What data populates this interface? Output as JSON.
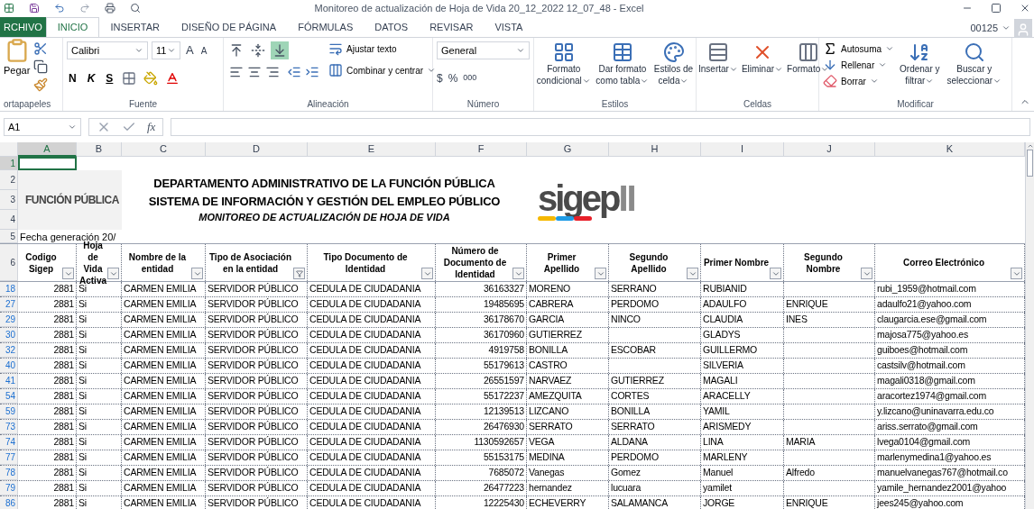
{
  "window": {
    "title": "Monitoreo de actualización de Hoja de Vida 20_12_2022 12_07_48 - Excel",
    "user": "00125"
  },
  "tabs": [
    {
      "label": "RCHIVO",
      "kind": "file",
      "selected": false
    },
    {
      "label": "INICIO",
      "kind": "tab",
      "selected": true
    },
    {
      "label": "INSERTAR",
      "kind": "tab",
      "selected": false
    },
    {
      "label": "DISEÑO DE PÁGINA",
      "kind": "tab",
      "selected": false
    },
    {
      "label": "FÓRMULAS",
      "kind": "tab",
      "selected": false
    },
    {
      "label": "DATOS",
      "kind": "tab",
      "selected": false
    },
    {
      "label": "REVISAR",
      "kind": "tab",
      "selected": false
    },
    {
      "label": "VISTA",
      "kind": "tab",
      "selected": false
    }
  ],
  "ribbon": {
    "portapapeles": {
      "paste": "Pegar",
      "label": "ortapapeles"
    },
    "fuente": {
      "font": "Calibri",
      "size": "11",
      "grow": "A",
      "shrink": "A",
      "bold": "N",
      "italic": "K",
      "underline": "S",
      "label": "Fuente"
    },
    "alineacion": {
      "vertical": [
        {
          "selected": false
        },
        {
          "selected": false
        },
        {
          "selected": true
        }
      ],
      "wrap": "Ajustar texto",
      "merge": "Combinar y centrar",
      "label": "Alineación"
    },
    "numero": {
      "format": "General",
      "currency": "$",
      "percent": "%",
      "thousands": "000",
      "label": "Número"
    },
    "estilos": {
      "buttons": [
        {
          "lines": [
            "Formato",
            "condicional"
          ]
        },
        {
          "lines": [
            "Dar formato",
            "como tabla"
          ]
        },
        {
          "lines": [
            "Estilos de",
            "celda"
          ]
        }
      ],
      "label": "Estilos"
    },
    "celdas": {
      "buttons": [
        "Insertar",
        "Eliminar",
        "Formato"
      ],
      "label": "Celdas"
    },
    "modificar": {
      "autosum": "Autosuma",
      "fill": "Rellenar",
      "clear": "Borrar",
      "buttons": [
        {
          "lines": [
            "Ordenar y",
            "filtrar"
          ]
        },
        {
          "lines": [
            "Buscar y",
            "seleccionar"
          ]
        }
      ],
      "label": "Modificar"
    }
  },
  "formula_bar": {
    "name_box": "A1",
    "fx": "fx"
  },
  "sheet": {
    "column_letters": [
      {
        "label": "A",
        "selected": true
      },
      {
        "label": "B",
        "selected": false
      },
      {
        "label": "C",
        "selected": false
      },
      {
        "label": "D",
        "selected": false
      },
      {
        "label": "E",
        "selected": false
      },
      {
        "label": "F",
        "selected": false
      },
      {
        "label": "G",
        "selected": false
      },
      {
        "label": "H",
        "selected": false
      },
      {
        "label": "I",
        "selected": false
      },
      {
        "label": "J",
        "selected": false
      },
      {
        "label": "K",
        "selected": false
      }
    ],
    "top_rows": [
      {
        "label": "1",
        "selected": true
      },
      {
        "label": "2",
        "selected": false
      },
      {
        "label": "3",
        "selected": false
      },
      {
        "label": "4",
        "selected": false
      },
      {
        "label": "5",
        "selected": false
      }
    ],
    "header": {
      "logo_text": "FUNCIÓN PÚBLICA",
      "titles": [
        "DEPARTAMENTO ADMINISTRATIVO DE LA FUNCIÓN PÚBLICA",
        "SISTEMA DE INFORMACIÓN Y GESTIÓN DEL EMPLEO PÚBLICO"
      ],
      "subtitle": "MONITOREO DE ACTUALIZACIÓN DE HOJA DE VIDA",
      "sigep": "sigep",
      "sigep_suffix": "II",
      "date": "Fecha generación 20/"
    },
    "table": {
      "row_number": "6",
      "columns": [
        {
          "label": "Codigo Sigep",
          "filter_active": false
        },
        {
          "label": "Hoja de Vida Activa",
          "filter_active": false
        },
        {
          "label": "Nombre de la entidad",
          "filter_active": false
        },
        {
          "label": "Tipo de Asociación en la entidad",
          "filter_active": true
        },
        {
          "label": "Tipo Documento de Identidad",
          "filter_active": false
        },
        {
          "label": "Número de Documento de Identidad",
          "filter_active": false
        },
        {
          "label": "Primer Apellido",
          "filter_active": false
        },
        {
          "label": "Segundo Apellido",
          "filter_active": false
        },
        {
          "label": "Primer Nombre",
          "filter_active": false
        },
        {
          "label": "Segundo Nombre",
          "filter_active": false
        },
        {
          "label": "Correo Electrónico",
          "filter_active": false
        }
      ],
      "rows": [
        {
          "row_number": "18",
          "cells": [
            "2881",
            "Si",
            "CARMEN EMILIA",
            "SERVIDOR PÚBLICO",
            "CEDULA DE CIUDADANIA",
            "36163327",
            "MORENO",
            "SERRANO",
            "RUBIANID",
            "",
            "rubi_1959@hotmail.com"
          ]
        },
        {
          "row_number": "27",
          "cells": [
            "2881",
            "Si",
            "CARMEN EMILIA",
            "SERVIDOR PÚBLICO",
            "CEDULA DE CIUDADANIA",
            "19485695",
            "CABRERA",
            "PERDOMO",
            "ADAULFO",
            "ENRIQUE",
            "adaulfo21@yahoo.com"
          ]
        },
        {
          "row_number": "29",
          "cells": [
            "2881",
            "Si",
            "CARMEN EMILIA",
            "SERVIDOR PÚBLICO",
            "CEDULA DE CIUDADANIA",
            "36178670",
            "GARCIA",
            "NINCO",
            "CLAUDIA",
            "INES",
            "claugarcia.ese@gmail.com"
          ]
        },
        {
          "row_number": "30",
          "cells": [
            "2881",
            "Si",
            "CARMEN EMILIA",
            "SERVIDOR PÚBLICO",
            "CEDULA DE CIUDADANIA",
            "36170960",
            "GUTIERREZ",
            "",
            "GLADYS",
            "",
            "majosa775@yahoo.es"
          ]
        },
        {
          "row_number": "32",
          "cells": [
            "2881",
            "Si",
            "CARMEN EMILIA",
            "SERVIDOR PÚBLICO",
            "CEDULA DE CIUDADANIA",
            "4919758",
            "BONILLA",
            "ESCOBAR",
            "GUILLERMO",
            "",
            "guiboes@hotmail.com"
          ]
        },
        {
          "row_number": "40",
          "cells": [
            "2881",
            "Si",
            "CARMEN EMILIA",
            "SERVIDOR PÚBLICO",
            "CEDULA DE CIUDADANIA",
            "55179613",
            "CASTRO",
            "",
            "SILVERIA",
            "",
            "castsilv@hotmail.com"
          ]
        },
        {
          "row_number": "41",
          "cells": [
            "2881",
            "Si",
            "CARMEN EMILIA",
            "SERVIDOR PÚBLICO",
            "CEDULA DE CIUDADANIA",
            "26551597",
            "NARVAEZ",
            "GUTIERREZ",
            "MAGALI",
            "",
            "magali0318@gmail.com"
          ]
        },
        {
          "row_number": "54",
          "cells": [
            "2881",
            "Si",
            "CARMEN EMILIA",
            "SERVIDOR PÚBLICO",
            "CEDULA DE CIUDADANIA",
            "55172237",
            "AMEZQUITA",
            "CORTES",
            "ARACELLY",
            "",
            "aracortez1974@gmail.com"
          ]
        },
        {
          "row_number": "59",
          "cells": [
            "2881",
            "Si",
            "CARMEN EMILIA",
            "SERVIDOR PÚBLICO",
            "CEDULA DE CIUDADANIA",
            "12139513",
            "LIZCANO",
            "BONILLA",
            "YAMIL",
            "",
            "y.lizcano@uninavarra.edu.co"
          ]
        },
        {
          "row_number": "73",
          "cells": [
            "2881",
            "Si",
            "CARMEN EMILIA",
            "SERVIDOR PÚBLICO",
            "CEDULA DE CIUDADANIA",
            "26476930",
            "SERRATO",
            "SERRATO",
            "ARISMEDY",
            "",
            "ariss.serrato@gmail.com"
          ]
        },
        {
          "row_number": "74",
          "cells": [
            "2881",
            "Si",
            "CARMEN EMILIA",
            "SERVIDOR PÚBLICO",
            "CEDULA DE CIUDADANIA",
            "1130592657",
            "VEGA",
            "ALDANA",
            "LINA",
            "MARIA",
            "lvega0104@gmail.com"
          ]
        },
        {
          "row_number": "77",
          "cells": [
            "2881",
            "Si",
            "CARMEN EMILIA",
            "SERVIDOR PÚBLICO",
            "CEDULA DE CIUDADANIA",
            "55153175",
            "MEDINA",
            "PERDOMO",
            "MARLENY",
            "",
            "marlenymedina1@yahoo.es"
          ]
        },
        {
          "row_number": "78",
          "cells": [
            "2881",
            "Si",
            "CARMEN EMILIA",
            "SERVIDOR PÚBLICO",
            "CEDULA DE CIUDADANIA",
            "7685072",
            "Vanegas",
            "Gomez",
            "Manuel",
            "Alfredo",
            "manuelvanegas767@hotmail.co"
          ]
        },
        {
          "row_number": "79",
          "cells": [
            "2881",
            "Si",
            "CARMEN EMILIA",
            "SERVIDOR PÚBLICO",
            "CEDULA DE CIUDADANIA",
            "26477223",
            "hernandez",
            "lucuara",
            "yamilet",
            "",
            "yamile_hernandez2001@yahoo"
          ]
        },
        {
          "row_number": "86",
          "cells": [
            "2881",
            "Si",
            "CARMEN EMILIA",
            "SERVIDOR PÚBLICO",
            "CEDULA DE CIUDADANIA",
            "12225430",
            "ECHEVERRY",
            "SALAMANCA",
            "JORGE",
            "ENRIQUE",
            "jees245@yahoo.com"
          ]
        }
      ]
    }
  }
}
